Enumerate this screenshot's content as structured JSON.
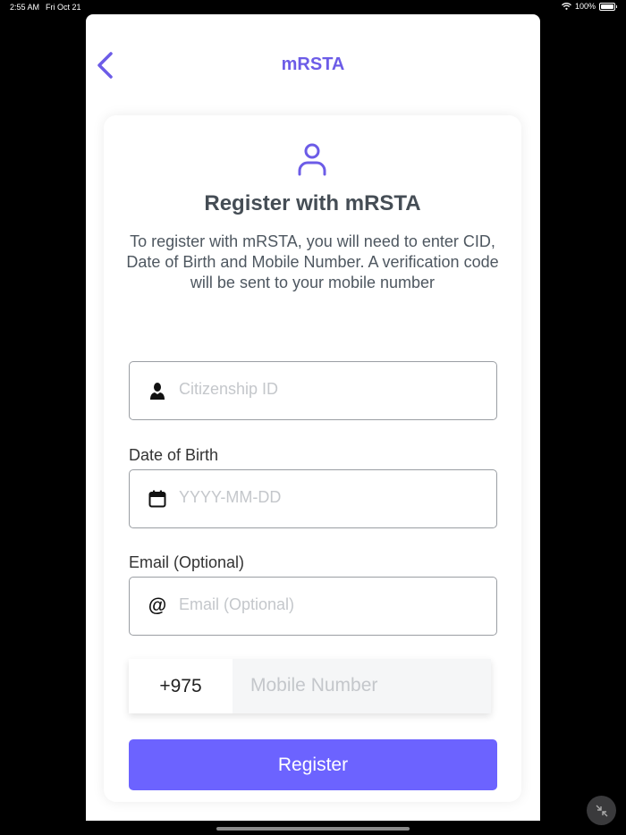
{
  "status_bar": {
    "time": "2:55 AM",
    "date": "Fri Oct 21",
    "battery": "100%"
  },
  "nav": {
    "title": "mRSTA",
    "back_icon": "chevron-left-icon"
  },
  "card": {
    "icon": "person-outline-icon",
    "title": "Register with mRSTA",
    "description": "To register with mRSTA, you will need to enter CID, Date of Birth and Mobile Number. A verification code will be sent to your mobile number"
  },
  "form": {
    "cid": {
      "placeholder": "Citizenship ID",
      "icon": "person-icon"
    },
    "dob": {
      "label": "Date of Birth",
      "placeholder": "YYYY-MM-DD",
      "icon": "calendar-icon"
    },
    "email": {
      "label": "Email (Optional)",
      "placeholder": "Email (Optional)",
      "icon": "at-icon"
    },
    "phone": {
      "country_code": "+975",
      "placeholder": "Mobile Number"
    },
    "submit_label": "Register"
  },
  "colors": {
    "accent": "#6c5ce7",
    "button": "#6c63ff",
    "text": "#454d55"
  }
}
